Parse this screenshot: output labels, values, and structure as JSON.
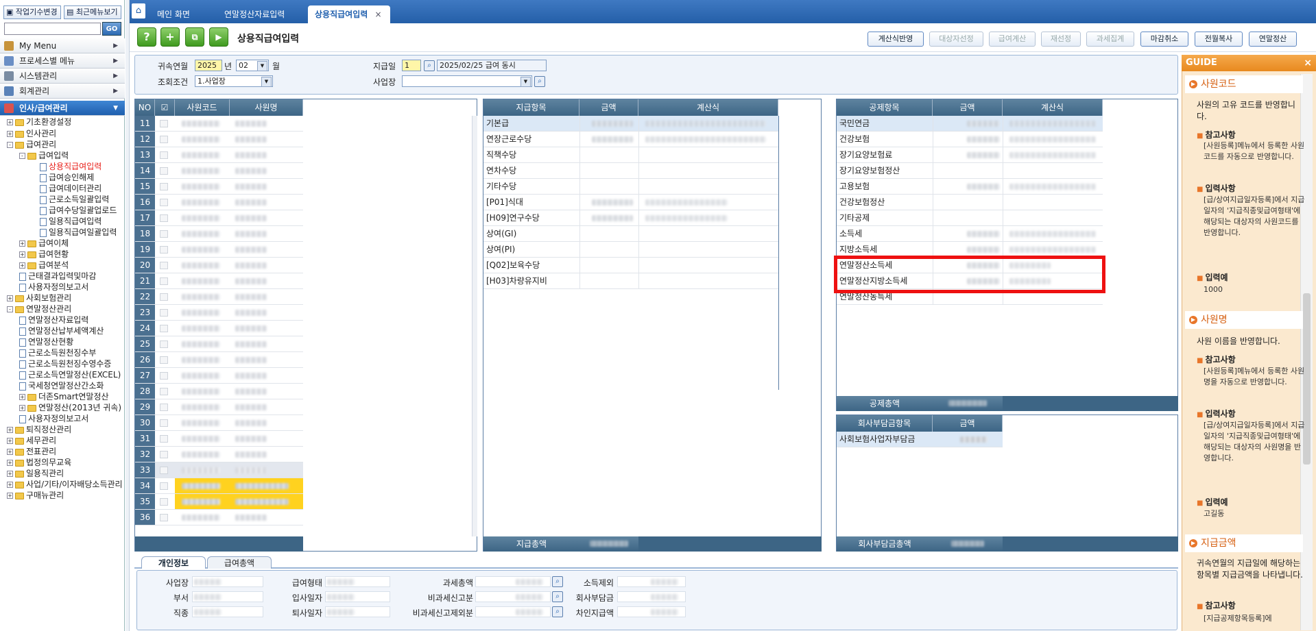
{
  "left": {
    "btn_work": "작업기수변경",
    "btn_recent": "최근메뉴보기",
    "go": "GO",
    "menus": [
      "My Menu",
      "프로세스별 메뉴",
      "시스템관리",
      "회계관리",
      "인사/급여관리"
    ],
    "tree": [
      "기초환경설정",
      "인사관리",
      "급여관리",
      "급여입력",
      "상용직급여입력",
      "급여승인해제",
      "급여데이터관리",
      "근로소득일괄입력",
      "급여수당일괄업로드",
      "일용직급여입력",
      "일용직급여일괄입력",
      "급여이체",
      "급여현황",
      "급여분석",
      "근태결과입력및마감",
      "사용자정의보고서",
      "사회보험관리",
      "연말정산관리",
      "연말정산자료입력",
      "연말정산납부세액계산",
      "연말정산현황",
      "근로소득원천징수부",
      "근로소득원천징수영수증",
      "근로소득연말정산(EXCEL)",
      "국세청연말정산간소화",
      "더존Smart연말정산",
      "연말정산(2013년 귀속)",
      "사용자정의보고서",
      "퇴직정산관리",
      "세무관리",
      "전표관리",
      "법정의무교육",
      "일용직관리",
      "사업/기타/이자배당소득관리",
      "구매뉴관리"
    ]
  },
  "tabs": [
    "메인 화면",
    "연말정산자료입력",
    "상용직급여입력"
  ],
  "page_title": "상용직급여입력",
  "toolbar": {
    "buttons": [
      "계산식반영",
      "대상자선정",
      "급여계산",
      "재선정",
      "과세집계",
      "마감취소",
      "전월복사",
      "연말정산"
    ]
  },
  "filter": {
    "lbl_year": "귀속연월",
    "year": "2025",
    "year_unit": "년",
    "month": "02",
    "month_unit": "월",
    "lbl_cond": "조회조건",
    "cond": "1.사업장",
    "lbl_paydate": "지급일",
    "paydate_no": "1",
    "paydate_desc": "2025/02/25 급여 동시",
    "lbl_site": "사업장"
  },
  "emp_grid": {
    "headers": [
      "NO",
      "사원코드",
      "사원명"
    ],
    "rows": [
      "11",
      "12",
      "13",
      "14",
      "15",
      "16",
      "17",
      "18",
      "19",
      "20",
      "21",
      "22",
      "23",
      "24",
      "25",
      "26",
      "27",
      "28",
      "29",
      "30",
      "31",
      "32",
      "33",
      "34",
      "35",
      "36"
    ]
  },
  "pay_grid": {
    "headers": [
      "지급항목",
      "금액",
      "계산식"
    ],
    "items": [
      "기본급",
      "연장근로수당",
      "직책수당",
      "연차수당",
      "기타수당",
      "[P01]식대",
      "[H09]연구수당",
      "상여(GI)",
      "상여(PI)",
      "[Q02]보육수당",
      "[H03]차량유지비"
    ],
    "footer": "지급총액"
  },
  "ded_grid": {
    "headers": [
      "공제항목",
      "금액",
      "계산식"
    ],
    "items": [
      "국민연금",
      "건강보험",
      "장기요양보험료",
      "장기요양보험정산",
      "고용보험",
      "건강보험정산",
      "기타공제",
      "소득세",
      "지방소득세",
      "연말정산소득세",
      "연말정산지방소득세",
      "연말정산농특세"
    ],
    "footer": "공제총액"
  },
  "comp_grid": {
    "headers": [
      "회사부담금항목",
      "금액"
    ],
    "items": [
      "사회보험사업자부담금"
    ],
    "footer": "회사부담금총액"
  },
  "guide": {
    "title": "GUIDE",
    "sections": [
      {
        "title": "사원코드",
        "desc": "사원의 고유 코드를 반영합니다.",
        "note_t": "참고사항",
        "note": "[사원등록]메뉴에서 등록한 사원코드를 자동으로 반영합니다.",
        "input_t": "입력사항",
        "input": "[급/상여지급일자등록]에서 지급일자의 '지급직종및급여형태'에 해당되는 대상자의 사원코드를 반영합니다.",
        "ex_t": "입력예",
        "ex": "1000"
      },
      {
        "title": "사원명",
        "desc": "사원 이름을 반영합니다.",
        "note_t": "참고사항",
        "note": "[사원등록]메뉴에서 등록한 사원명을 자동으로 반영합니다.",
        "input_t": "입력사항",
        "input": "[급/상여지급일자등록]에서 지급일자의 '지급직종및급여형태'에 해당되는 대상자의 사원명을 반영합니다.",
        "ex_t": "입력예",
        "ex": "고길동"
      },
      {
        "title": "지급금액",
        "desc": "귀속연월의 지급일에 해당하는 항목별 지급금액을 나타냅니다.",
        "note_t": "참고사항",
        "note": "[지급공제항목등록]에"
      }
    ]
  },
  "bottom": {
    "tabs": [
      "개인정보",
      "급여총액"
    ],
    "labels": [
      "사업장",
      "부서",
      "직종",
      "급여형태",
      "입사일자",
      "퇴사일자",
      "과세총액",
      "비과세신고분",
      "비과세신고제외분",
      "소득제외",
      "회사부담금",
      "차인지급액"
    ]
  }
}
